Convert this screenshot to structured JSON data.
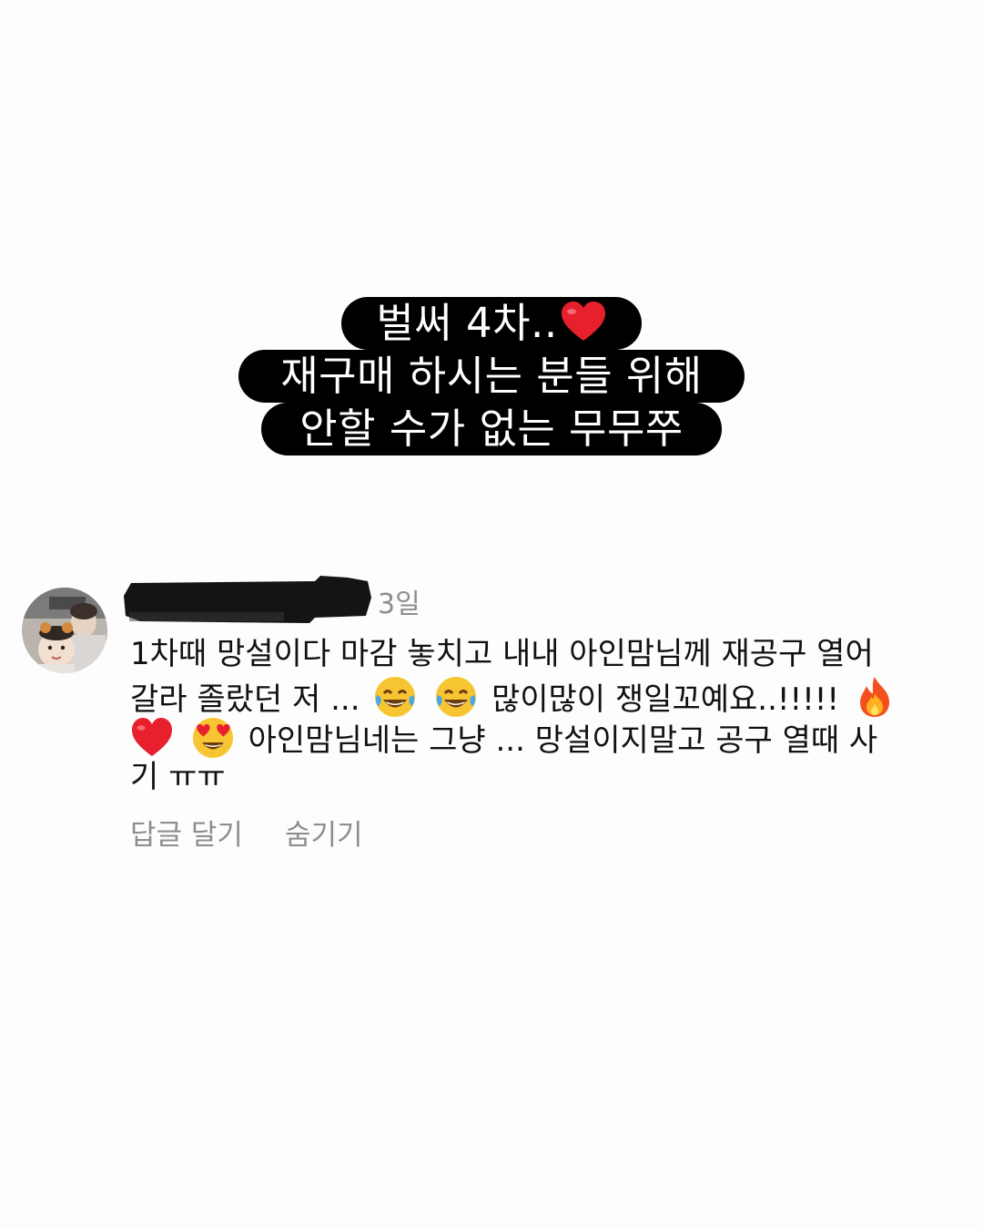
{
  "caption": {
    "line1": "벌써 4차..",
    "line2": "재구매 하시는 분들 위해",
    "line3": "안할 수가 없는 무무쭈",
    "line1_emoji": "red-heart"
  },
  "comment": {
    "time": "3일",
    "line1": "1차때 망설이다 마감 놓치고 내내 아인맘님께 재공구 열어",
    "line2_a": "갈라 졸랐던 저 ...",
    "line2_b": "많이많이 쟁일꼬예요..!!!!!",
    "line3_a": "아인맘님네는 그냥 ... 망설이지말고 공구 열때 사",
    "line4": "기 ㅠㅠ",
    "emojis": [
      "joy",
      "joy",
      "fire",
      "red-heart",
      "heart-eyes"
    ]
  },
  "actions": {
    "reply": "답글 달기",
    "hide": "숨기기"
  },
  "colors": {
    "background": "#fdfdfd",
    "caption_bg": "#000000",
    "caption_text": "#ffffff",
    "muted_text": "#8e8e8e"
  }
}
